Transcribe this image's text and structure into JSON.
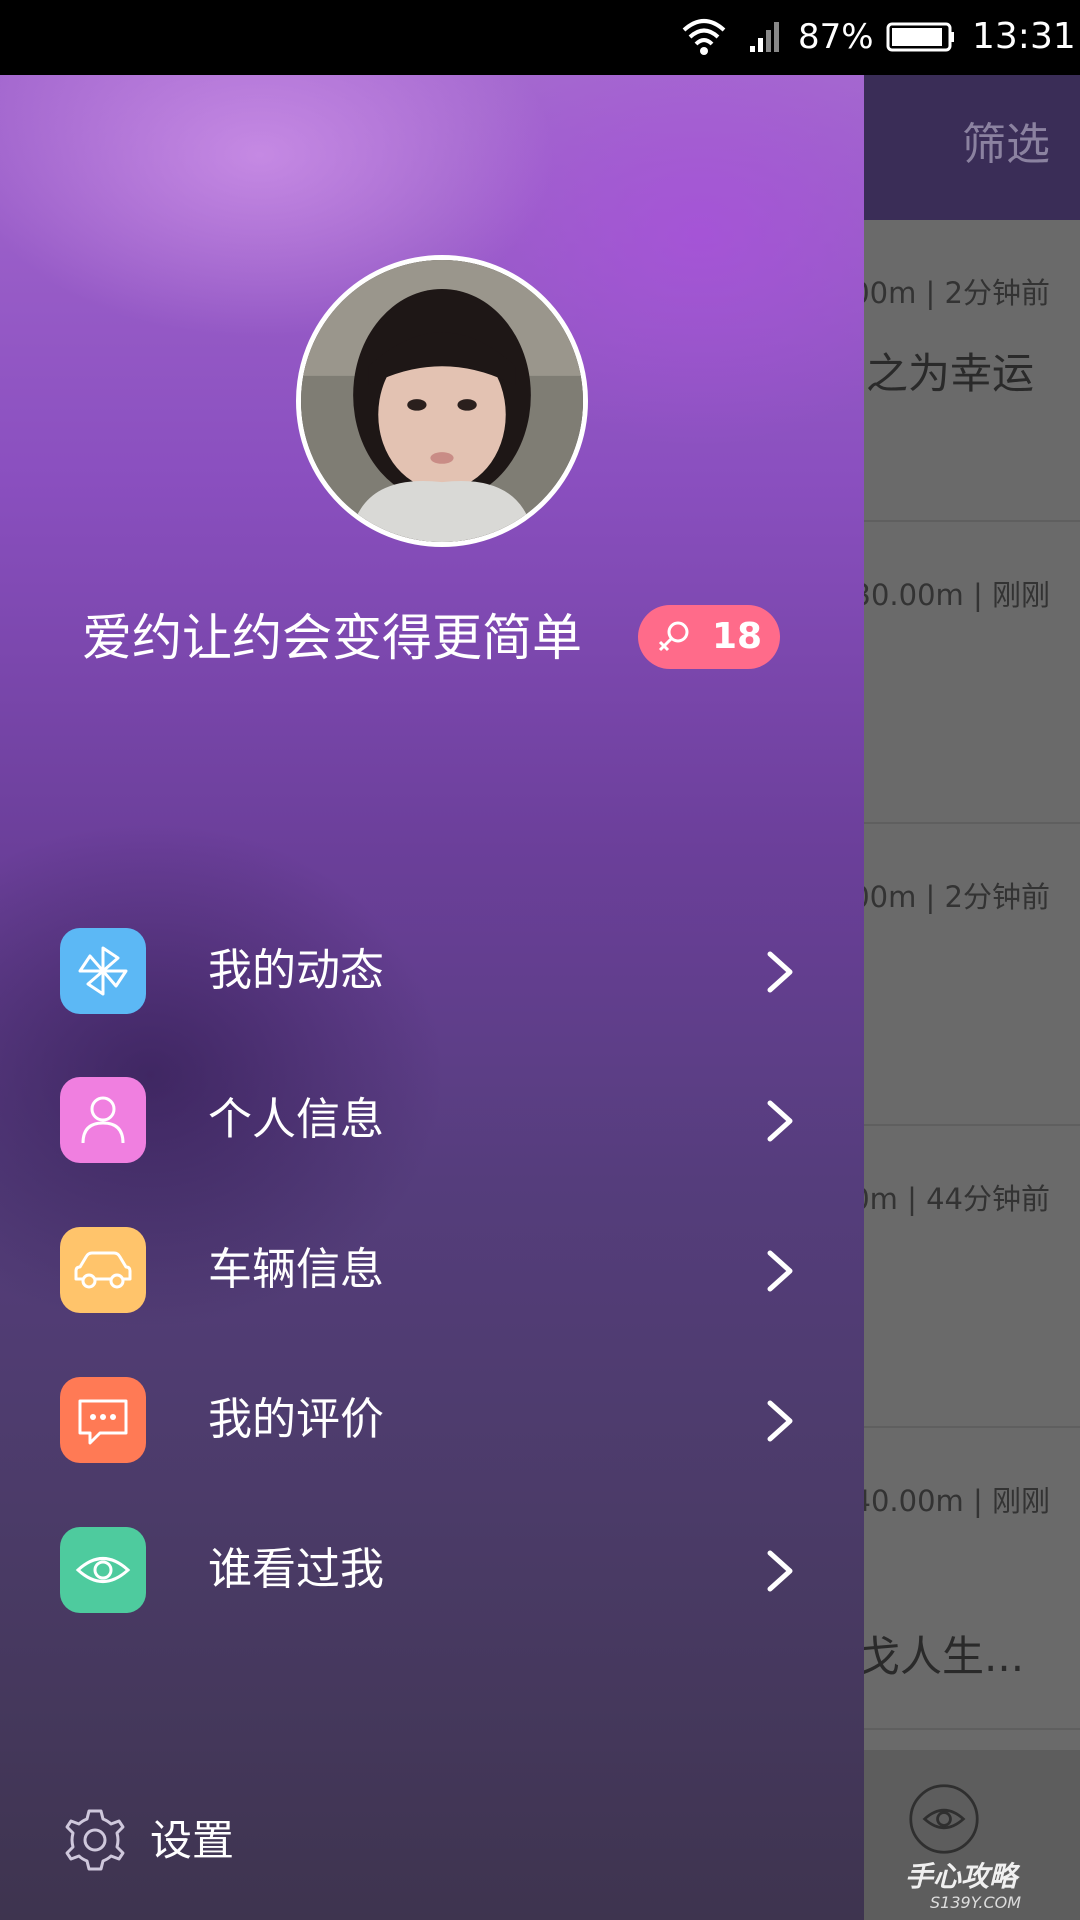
{
  "status_bar": {
    "battery_percent": "87%",
    "time": "13:31"
  },
  "background_page": {
    "filter_label": "筛选",
    "cards": [
      {
        "meta": "00m | 2分钟前",
        "snippet": "之为幸运"
      },
      {
        "meta": "30.00m | 刚刚",
        "snippet": ""
      },
      {
        "meta": "00m | 2分钟前",
        "snippet": ""
      },
      {
        "meta": "0m | 44分钟前",
        "snippet": ""
      },
      {
        "meta": "40.00m | 刚刚",
        "snippet": "戈人生..."
      }
    ],
    "watermark": "手心攻略",
    "watermark_sub": "S139Y.COM"
  },
  "drawer": {
    "tagline": "爱约让约会变得更简单",
    "age": "18",
    "gender_icon": "female-icon",
    "menu": [
      {
        "label": "我的动态",
        "icon": "pinwheel-icon",
        "color": "#5cb8f5"
      },
      {
        "label": "个人信息",
        "icon": "person-icon",
        "color": "#f07fe0"
      },
      {
        "label": "车辆信息",
        "icon": "car-icon",
        "color": "#ffc46b"
      },
      {
        "label": "我的评价",
        "icon": "chat-icon",
        "color": "#ff7a55"
      },
      {
        "label": "谁看过我",
        "icon": "eye-icon",
        "color": "#4ecb9e"
      }
    ],
    "settings_label": "设置"
  }
}
